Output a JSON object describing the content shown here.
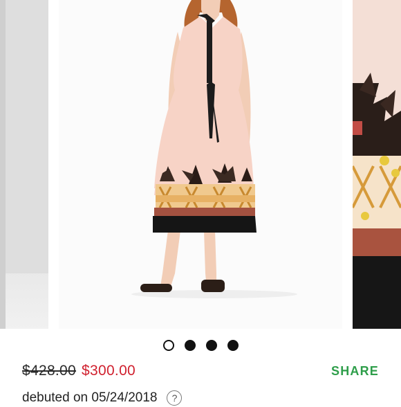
{
  "carousel": {
    "slide_count": 4,
    "active_index": 0
  },
  "pricing": {
    "original_price": "$428.00",
    "sale_price": "$300.00",
    "sale_color": "#d0202e"
  },
  "actions": {
    "share_label": "SHARE",
    "share_color": "#2e9e4a"
  },
  "listing": {
    "debut_text": "debuted on 05/24/2018",
    "help_icon": "question-mark-icon",
    "help_glyph": "?"
  }
}
